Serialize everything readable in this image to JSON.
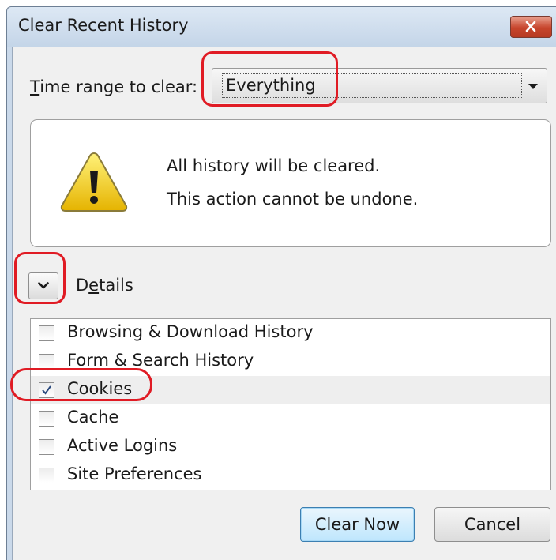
{
  "window": {
    "title": "Clear Recent History"
  },
  "time_range": {
    "label_pre": "",
    "label_accel": "T",
    "label_post": "ime range to clear:",
    "selected": "Everything"
  },
  "warning": {
    "line1": "All history will be cleared.",
    "line2": "This action cannot be undone."
  },
  "details": {
    "label_pre": "D",
    "label_accel": "e",
    "label_post": "tails"
  },
  "history_items": [
    {
      "label": "Browsing & Download History",
      "checked": false
    },
    {
      "label": "Form & Search History",
      "checked": false
    },
    {
      "label": "Cookies",
      "checked": true
    },
    {
      "label": "Cache",
      "checked": false
    },
    {
      "label": "Active Logins",
      "checked": false
    },
    {
      "label": "Site Preferences",
      "checked": false
    }
  ],
  "buttons": {
    "clear_now": "Clear Now",
    "cancel": "Cancel"
  },
  "colors": {
    "highlight": "#e01b24",
    "titlebar": "#c4d5e8",
    "close_button": "#c7452c",
    "default_button": "#bee6fd",
    "checkmark": "#2b4a7e"
  }
}
